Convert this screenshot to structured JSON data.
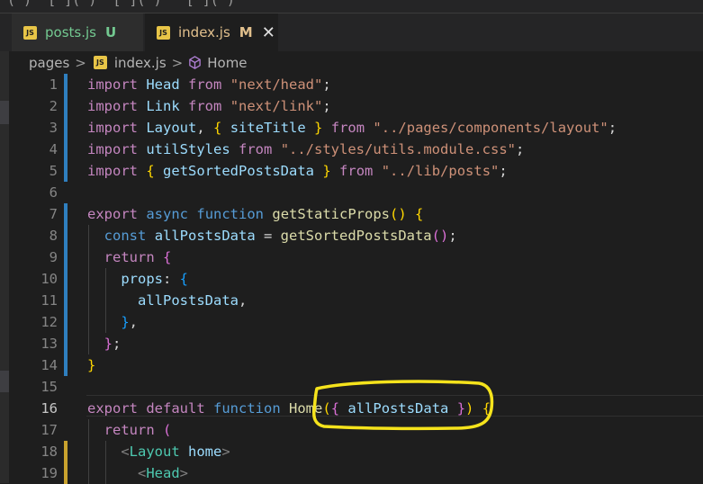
{
  "tabs": [
    {
      "icon": "JS",
      "name": "posts.js",
      "status": "U",
      "active": false
    },
    {
      "icon": "JS",
      "name": "index.js",
      "status": "M",
      "active": true
    }
  ],
  "close_glyph": "✕",
  "breadcrumb": {
    "folder": "pages",
    "file_icon": "JS",
    "file": "index.js",
    "symbol_icon": "cube-icon",
    "symbol": "Home",
    "separator": ">"
  },
  "editor": {
    "lines": [
      {
        "n": "1",
        "bar": "added",
        "tokens": [
          [
            "kw",
            "import"
          ],
          [
            "plain",
            " "
          ],
          [
            "var",
            "Head"
          ],
          [
            "plain",
            " "
          ],
          [
            "kw",
            "from"
          ],
          [
            "plain",
            " "
          ],
          [
            "str",
            "\"next/head\""
          ],
          [
            "plain",
            ";"
          ]
        ]
      },
      {
        "n": "2",
        "bar": "added",
        "tokens": [
          [
            "kw",
            "import"
          ],
          [
            "plain",
            " "
          ],
          [
            "var",
            "Link"
          ],
          [
            "plain",
            " "
          ],
          [
            "kw",
            "from"
          ],
          [
            "plain",
            " "
          ],
          [
            "str",
            "\"next/link\""
          ],
          [
            "plain",
            ";"
          ]
        ]
      },
      {
        "n": "3",
        "bar": "added",
        "tokens": [
          [
            "kw",
            "import"
          ],
          [
            "plain",
            " "
          ],
          [
            "var",
            "Layout"
          ],
          [
            "plain",
            ", "
          ],
          [
            "br1",
            "{"
          ],
          [
            "plain",
            " "
          ],
          [
            "var",
            "siteTitle"
          ],
          [
            "plain",
            " "
          ],
          [
            "br1",
            "}"
          ],
          [
            "plain",
            " "
          ],
          [
            "kw",
            "from"
          ],
          [
            "plain",
            " "
          ],
          [
            "str",
            "\"../pages/components/layout\""
          ],
          [
            "plain",
            ";"
          ]
        ]
      },
      {
        "n": "4",
        "bar": "added",
        "tokens": [
          [
            "kw",
            "import"
          ],
          [
            "plain",
            " "
          ],
          [
            "var",
            "utilStyles"
          ],
          [
            "plain",
            " "
          ],
          [
            "kw",
            "from"
          ],
          [
            "plain",
            " "
          ],
          [
            "str",
            "\"../styles/utils.module.css\""
          ],
          [
            "plain",
            ";"
          ]
        ]
      },
      {
        "n": "5",
        "bar": "added",
        "tokens": [
          [
            "kw",
            "import"
          ],
          [
            "plain",
            " "
          ],
          [
            "br1",
            "{"
          ],
          [
            "plain",
            " "
          ],
          [
            "var",
            "getSortedPostsData"
          ],
          [
            "plain",
            " "
          ],
          [
            "br1",
            "}"
          ],
          [
            "plain",
            " "
          ],
          [
            "kw",
            "from"
          ],
          [
            "plain",
            " "
          ],
          [
            "str",
            "\"../lib/posts\""
          ],
          [
            "plain",
            ";"
          ]
        ]
      },
      {
        "n": "6",
        "bar": "",
        "tokens": []
      },
      {
        "n": "7",
        "bar": "added",
        "tokens": [
          [
            "kw",
            "export"
          ],
          [
            "plain",
            " "
          ],
          [
            "kw2",
            "async"
          ],
          [
            "plain",
            " "
          ],
          [
            "kw2",
            "function"
          ],
          [
            "plain",
            " "
          ],
          [
            "fn",
            "getStaticProps"
          ],
          [
            "br1",
            "()"
          ],
          [
            "plain",
            " "
          ],
          [
            "br1",
            "{"
          ]
        ]
      },
      {
        "n": "8",
        "bar": "added",
        "tokens": [
          [
            "plain",
            "  "
          ],
          [
            "kw2",
            "const"
          ],
          [
            "plain",
            " "
          ],
          [
            "var",
            "allPostsData"
          ],
          [
            "plain",
            " = "
          ],
          [
            "fn",
            "getSortedPostsData"
          ],
          [
            "br2",
            "()"
          ],
          [
            "plain",
            ";"
          ]
        ]
      },
      {
        "n": "9",
        "bar": "added",
        "tokens": [
          [
            "plain",
            "  "
          ],
          [
            "kw",
            "return"
          ],
          [
            "plain",
            " "
          ],
          [
            "br2",
            "{"
          ]
        ]
      },
      {
        "n": "10",
        "bar": "added",
        "tokens": [
          [
            "plain",
            "    "
          ],
          [
            "var",
            "props"
          ],
          [
            "plain",
            ": "
          ],
          [
            "br3",
            "{"
          ]
        ]
      },
      {
        "n": "11",
        "bar": "added",
        "tokens": [
          [
            "plain",
            "      "
          ],
          [
            "var",
            "allPostsData"
          ],
          [
            "plain",
            ","
          ]
        ]
      },
      {
        "n": "12",
        "bar": "added",
        "tokens": [
          [
            "plain",
            "    "
          ],
          [
            "br3",
            "}"
          ],
          [
            "plain",
            ","
          ]
        ]
      },
      {
        "n": "13",
        "bar": "added",
        "tokens": [
          [
            "plain",
            "  "
          ],
          [
            "br2",
            "}"
          ],
          [
            "plain",
            ";"
          ]
        ]
      },
      {
        "n": "14",
        "bar": "added",
        "tokens": [
          [
            "br1",
            "}"
          ]
        ]
      },
      {
        "n": "15",
        "bar": "",
        "tokens": []
      },
      {
        "n": "16",
        "bar": "",
        "current": true,
        "tokens": [
          [
            "kw",
            "export"
          ],
          [
            "plain",
            " "
          ],
          [
            "kw",
            "default"
          ],
          [
            "plain",
            " "
          ],
          [
            "kw2",
            "function"
          ],
          [
            "plain",
            " "
          ],
          [
            "fn",
            "Home"
          ],
          [
            "br1",
            "("
          ],
          [
            "br2",
            "{"
          ],
          [
            "plain",
            " "
          ],
          [
            "var",
            "allPostsData"
          ],
          [
            "plain",
            " "
          ],
          [
            "br2",
            "}"
          ],
          [
            "br1",
            ")"
          ],
          [
            "plain",
            " "
          ],
          [
            "br1",
            "{"
          ]
        ]
      },
      {
        "n": "17",
        "bar": "",
        "tokens": [
          [
            "plain",
            "  "
          ],
          [
            "kw",
            "return"
          ],
          [
            "plain",
            " "
          ],
          [
            "br2",
            "("
          ]
        ]
      },
      {
        "n": "18",
        "bar": "mod",
        "tokens": [
          [
            "plain",
            "    "
          ],
          [
            "punct",
            "<"
          ],
          [
            "tag",
            "Layout"
          ],
          [
            "plain",
            " "
          ],
          [
            "var",
            "home"
          ],
          [
            "punct",
            ">"
          ]
        ]
      },
      {
        "n": "19",
        "bar": "mod",
        "tokens": [
          [
            "plain",
            "      "
          ],
          [
            "punct",
            "<"
          ],
          [
            "tag",
            "Head"
          ],
          [
            "punct",
            ">"
          ]
        ]
      }
    ]
  },
  "top_strip_text": "( )  [ ]( )  [ ]( )   [ ]( )",
  "colors": {
    "annotation": "#f5e31c",
    "added_bar": "#2f7fbf",
    "modified_bar": "#c9a22e"
  }
}
